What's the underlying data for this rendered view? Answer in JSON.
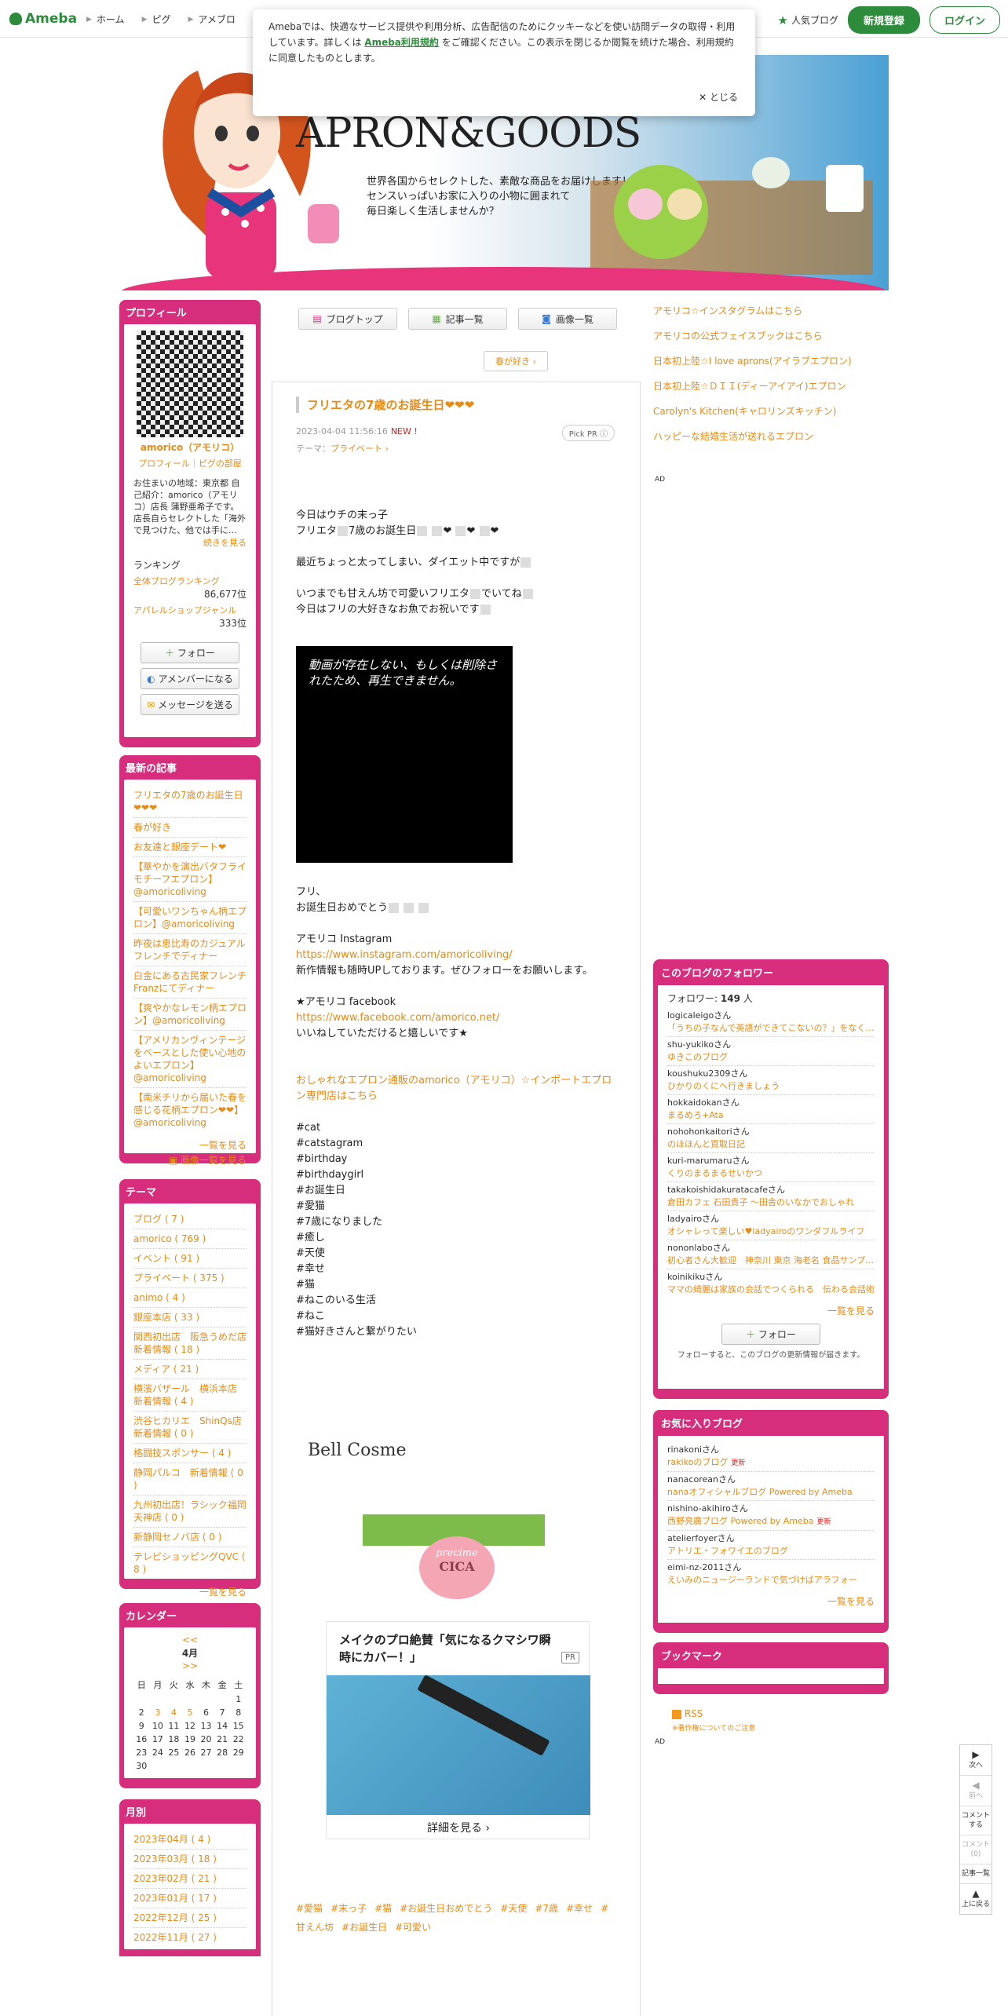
{
  "header": {
    "logo": "Ameba",
    "nav": [
      "ホーム",
      "ピグ",
      "アメブロ"
    ],
    "popular": "人気ブログ",
    "signup": "新規登録",
    "login": "ログイン"
  },
  "cookie": {
    "text_before": "Amebaでは、快適なサービス提供や利用分析、広告配信のためにクッキーなどを使い訪問データの取得・利用しています。詳しくは",
    "link": "Ameba利用規約",
    "text_after": "をご確認ください。この表示を閉じるか閲覧を続けた場合、利用規約に同意したものとします。",
    "close": "とじる"
  },
  "banner": {
    "title": "APRON&GOODS",
    "sub1": "世界各国からセレクトした、素敵な商品をお届けします！",
    "sub2": "センスいっぱいお家に入りの小物に囲まれて",
    "sub3": "毎日楽しく生活しませんか？"
  },
  "profile": {
    "heading": "プロフィール",
    "name": "amorico（アモリコ）",
    "links": "プロフィール｜ピグの部屋",
    "desc": "お住まいの地域：東京都 自己紹介：amorico（アモリコ）店長 蒲野亜希子です。店長自らセレクトした「海外で見つけた、他では手に...",
    "more": "続きを見る",
    "ranking_label": "ランキング",
    "rank1_label": "全体ブログランキング",
    "rank1_value": "86,677位",
    "rank2_label": "アパレルショップジャンル",
    "rank2_value": "333位",
    "btn_follow": "フォロー",
    "btn_member": "アメンバーになる",
    "btn_message": "メッセージを送る"
  },
  "latest": {
    "heading": "最新の記事",
    "items": [
      "フリエタの7歳のお誕生日❤❤❤",
      "春が好き",
      "お友達と銀座デート❤",
      "【華やかを演出バタフライモチーフエプロン】@amoricoliving",
      "【可愛いワンちゃん柄エプロン】@amoricoliving",
      "昨夜は恵比寿のカジュアルフレンチでディナー",
      "白金にある古民家フレンチFranzにてディナー",
      "【爽やかなレモン柄エプロン】@amoricoliving",
      "【アメリカンヴィンテージをベースとした使い心地のよいエプロン】@amoricoliving",
      "【南米チリから届いた春を感じる花柄エプロン❤❤】@amoricoliving"
    ],
    "more1": "一覧を見る",
    "more2": "画像一覧を見る"
  },
  "themes": {
    "heading": "テーマ",
    "items": [
      "ブログ ( 7 )",
      "amorico ( 769 )",
      "イベント ( 91 )",
      "プライベート ( 375 )",
      "animo ( 4 )",
      "銀座本店 ( 33 )",
      "関西初出店　阪急うめだ店　新着情報 ( 18 )",
      "メディア ( 21 )",
      "横濱バザール　横浜本店　新着情報 ( 4 )",
      "渋谷ヒカリエ　ShinQs店　新着情報 ( 0 )",
      "格闘技スポンサー ( 4 )",
      "静岡パルコ　新着情報 ( 0 )",
      "九州初出店！ラシック福岡天神店 ( 0 )",
      "新静岡セノバ店 ( 0 )",
      "テレビショッピングQVC ( 8 )"
    ],
    "more": "一覧を見る"
  },
  "calendar": {
    "heading": "カレンダー",
    "prev": "<<",
    "month": "4月",
    "next": ">>",
    "weekdays": [
      "日",
      "月",
      "火",
      "水",
      "木",
      "金",
      "土"
    ],
    "weeks": [
      [
        "",
        "",
        "",
        "",
        "",
        "",
        "1"
      ],
      [
        "2",
        "3",
        "4",
        "5",
        "6",
        "7",
        "8"
      ],
      [
        "9",
        "10",
        "11",
        "12",
        "13",
        "14",
        "15"
      ],
      [
        "16",
        "17",
        "18",
        "19",
        "20",
        "21",
        "22"
      ],
      [
        "23",
        "24",
        "25",
        "26",
        "27",
        "28",
        "29"
      ],
      [
        "30",
        "",
        "",
        "",
        "",
        "",
        ""
      ]
    ]
  },
  "monthly": {
    "heading": "月別",
    "items": [
      "2023年04月 ( 4 )",
      "2023年03月 ( 18 )",
      "2023年02月 ( 21 )",
      "2023年01月 ( 17 )",
      "2022年12月 ( 25 )",
      "2022年11月 ( 27 )"
    ]
  },
  "nav": {
    "blog_top": "ブログトップ",
    "articles": "記事一覧",
    "images": "画像一覧",
    "prev_article": "春が好き"
  },
  "article": {
    "title": "フリエタの7歳のお誕生日❤❤❤",
    "date": "2023-04-04 11:56:16",
    "new": "NEW !",
    "pickpr": "Pick PR ⓘ",
    "theme_label": "テーマ：",
    "theme": "プライベート",
    "l1": "今日はウチの末っ子",
    "l2": "フリエタ",
    "l2b": "7歳のお誕生日",
    "l3": "最近ちょっと太ってしまい、ダイエット中ですが",
    "l4": "いつまでも甘えん坊で可愛いフリエタ",
    "l4b": "でいてね",
    "l5": "今日はフリの大好きなお魚でお祝いです",
    "video": "動画が存在しない、もしくは削除されたため、再生できません。",
    "l6": "フリ、",
    "l7": "お誕生日おめでとう",
    "insta_label": "アモリコ Instagram",
    "insta_url": "https://www.instagram.com/amoricoliving/",
    "insta_note": "新作情報も随時UPしております。ぜひフォローをお願いします。",
    "fb_label": "★アモリコ facebook",
    "fb_url": "https://www.facebook.com/amorico.net/",
    "fb_note": "いいねしていただけると嬉しいです★",
    "shop_link": "おしゃれなエプロン通販のamorico（アモリコ）☆インポートエプロン専門店はこちら",
    "tags": [
      "#cat",
      "#catstagram",
      "#birthday",
      "#birthdaygirl",
      "#お誕生日",
      "#愛猫",
      "#7歳になりました",
      "#癒し",
      "#天使",
      "#幸せ",
      "#猫",
      "#ねこのいる生活",
      "#ねこ",
      "#猫好きさんと繋がりたい"
    ],
    "bell": "Bell Cosme",
    "cica_small": "precime",
    "cica_big": "CICA",
    "pr_title": "メイクのプロ絶賛「気になるクマシワ瞬時にカバー！」",
    "pr_tag": "PR",
    "pr_more": "詳細を見る",
    "hashtags": [
      "#愛猫",
      "#末っ子",
      "#猫",
      "#お誕生日おめでとう",
      "#天使",
      "#7歳",
      "#幸せ",
      "#甘えん坊",
      "#お誕生日",
      "#可愛い"
    ]
  },
  "right": {
    "links": [
      "アモリコ☆インスタグラムはこちら",
      "アモリコの公式フェイスブックはこちら",
      "日本初上陸☆I love aprons(アイラブエプロン)",
      "日本初上陸☆ＤＩＩ(ディーアイアイ)エプロン",
      "Carolyn's Kitchen(キャロリンズキッチン)",
      "ハッピーな結婚生活が送れるエプロン"
    ],
    "ad": "AD",
    "followers_heading": "このブログのフォロワー",
    "follower_label": "フォロワー:",
    "follower_count": "149",
    "follower_unit": "人",
    "followers": [
      {
        "user": "logicaleigoさん",
        "blog": "「うちの子なんで英語ができてこないの？」をなくすブログ"
      },
      {
        "user": "shu-yukikoさん",
        "blog": "ゆきこのブログ"
      },
      {
        "user": "koushuku2309さん",
        "blog": "ひかりのくにへ行きましょう"
      },
      {
        "user": "hokkaidokanさん",
        "blog": "まるめろ+Ata"
      },
      {
        "user": "nohohonkaitoriさん",
        "blog": "のほほんと買取日記"
      },
      {
        "user": "kuri-marumaruさん",
        "blog": "くりのまるまるせいかつ"
      },
      {
        "user": "takakoishidakuratacafeさん",
        "blog": "倉田カフェ 石田貴子 ～田舎のいなかでおしゃれ"
      },
      {
        "user": "ladyairoさん",
        "blog": "オシャレって楽しい♥ladyairoのワンダフルライフ"
      },
      {
        "user": "nononlaboさん",
        "blog": "初心者さん大歓迎　神奈川 東京 海老名 食品サンプル教室"
      },
      {
        "user": "koinikikuさん",
        "blog": "ママの綺麗は家族の会話でつくられる　伝わる会話術"
      }
    ],
    "followers_more": "一覧を見る",
    "follow_btn": "フォロー",
    "follow_note": "フォローすると、このブログの更新情報が届きます。",
    "fav_heading": "お気に入りブログ",
    "favs": [
      {
        "user": "rinakoniさん",
        "blog": "rakikoのブログ",
        "up": "更新"
      },
      {
        "user": "nanacoreanさん",
        "blog": "nanaオフィシャルブログ Powered by Ameba",
        "up": ""
      },
      {
        "user": "nishino-akihiroさん",
        "blog": "西野亮廣ブログ Powered by Ameba",
        "up": "更新"
      },
      {
        "user": "atelierfoyerさん",
        "blog": "アトリエ・フォワイエのブログ",
        "up": ""
      },
      {
        "user": "eimi-nz-2011さん",
        "blog": "えいみのニュージーランドで気づけばアラフォー"
      }
    ],
    "favs_more": "一覧を見る",
    "bookmark_heading": "ブックマーク",
    "rss": "RSS",
    "copyright": "※著作権についてのご注意",
    "ad2": "AD"
  },
  "sidenav": {
    "next": "次へ",
    "prev": "前へ",
    "comment": "コメントする",
    "comment_count": "コメント(0)",
    "list": "記事一覧",
    "top": "上に戻る"
  }
}
